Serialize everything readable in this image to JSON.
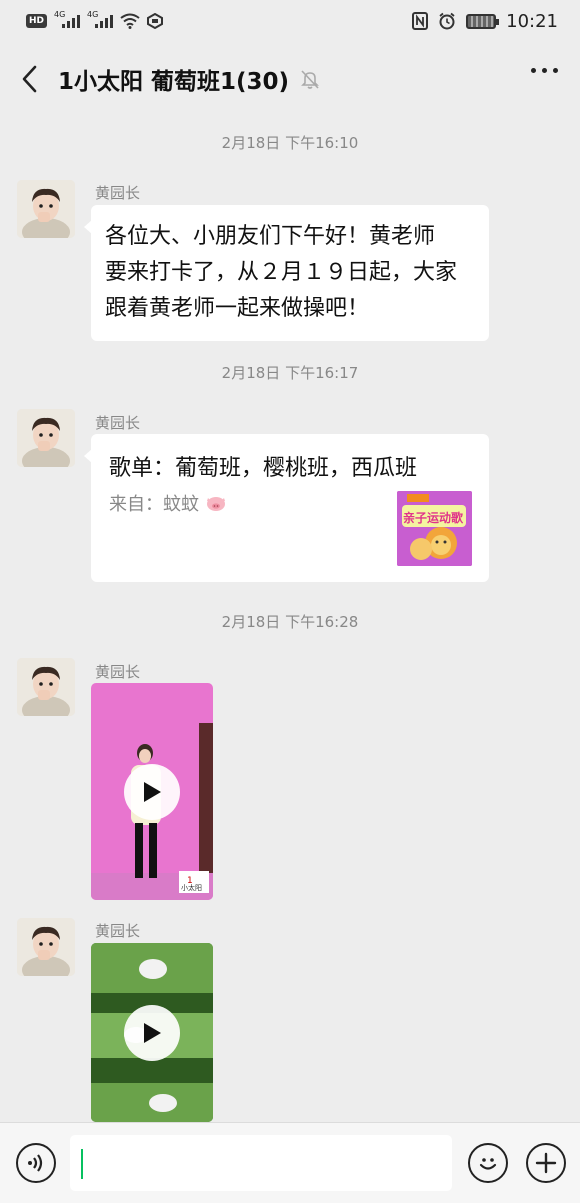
{
  "status_bar": {
    "hd": "HD",
    "network_1": "4G",
    "network_2": "4G",
    "time": "10:21"
  },
  "header": {
    "title": "1小太阳 葡萄班1(30)"
  },
  "messages": [
    {
      "timestamp": "2月18日 下午16:10",
      "sender": "黄园长",
      "type": "text",
      "lines": [
        "各位大、小朋友们下午好！黄老师",
        "要来打卡了，从２月１９日起，大家",
        "跟着黄老师一起来做操吧！"
      ]
    },
    {
      "timestamp": "2月18日 下午16:17",
      "sender": "黄园长",
      "type": "link-card",
      "card_title": "歌单：葡萄班，樱桃班，西瓜班",
      "card_from": "来自：蚊蚊",
      "thumb_text": "亲子运动歌"
    },
    {
      "timestamp": "2月18日 下午16:28",
      "sender": "黄园长",
      "type": "video",
      "watermark": "小太阳"
    },
    {
      "sender": "黄园长",
      "type": "video"
    }
  ],
  "colors": {
    "background": "#ededed",
    "bubble": "#ffffff",
    "caret": "#07c160"
  },
  "icons": {
    "back": "chevron-left-icon",
    "mute": "bell-off-icon",
    "more": "more-dots-icon",
    "voice": "voice-icon",
    "emoji": "emoji-icon",
    "plus": "plus-icon"
  }
}
